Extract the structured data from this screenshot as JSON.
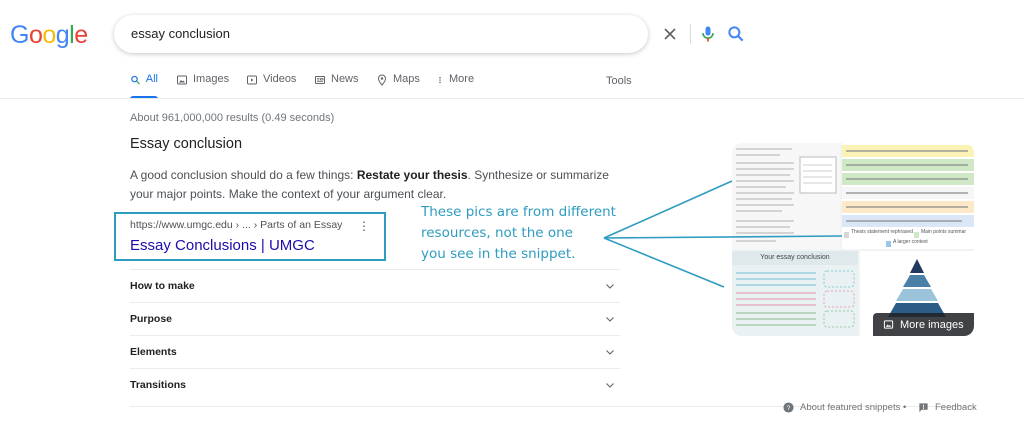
{
  "logo": {
    "text": "Google",
    "colors": [
      "#4285F4",
      "#EA4335",
      "#FBBC05",
      "#4285F4",
      "#34A853",
      "#EA4335"
    ]
  },
  "search": {
    "query": "essay conclusion",
    "icons": [
      "close-icon",
      "microphone-icon",
      "search-icon"
    ]
  },
  "tabs": [
    {
      "label": "All",
      "icon": "search-icon",
      "active": true
    },
    {
      "label": "Images",
      "icon": "image-icon"
    },
    {
      "label": "Videos",
      "icon": "play-icon"
    },
    {
      "label": "News",
      "icon": "news-icon"
    },
    {
      "label": "Maps",
      "icon": "map-pin-icon"
    },
    {
      "label": "More",
      "icon": "more-vert-icon"
    }
  ],
  "tools_label": "Tools",
  "stats": "About 961,000,000 results (0.49 seconds)",
  "snippet": {
    "title": "Essay conclusion",
    "text_before": "A good conclusion should do a few things: ",
    "text_bold": "Restate your thesis",
    "text_after": ". Synthesize or summarize your major points. Make the context of your argument clear.",
    "cite": "https://www.umgc.edu › ... › Parts of an Essay",
    "kebab": "⋮",
    "link": "Essay Conclusions | UMGC"
  },
  "accordion": [
    "How to make",
    "Purpose",
    "Elements",
    "Transitions"
  ],
  "annotation": [
    "These pics are from different",
    "resources, not the one",
    "you see in the snippet."
  ],
  "images": {
    "diagram_title": "Your essay conclusion",
    "legend_left": "Thesis statement rephrased",
    "legend_mid": "Main points summar",
    "legend_bottom": "A larger context",
    "more_images": "More images"
  },
  "footer": {
    "about": "About featured snippets",
    "dot": "•",
    "feedback": "Feedback"
  },
  "colors": {
    "accent": "#1a73e8",
    "link": "#1a0dab",
    "annotation": "#2e9cc0"
  }
}
